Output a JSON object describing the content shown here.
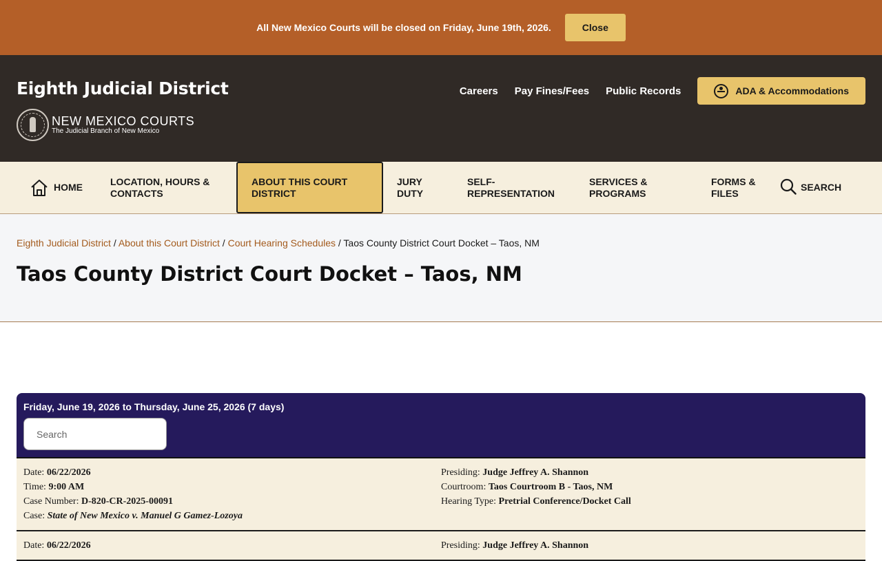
{
  "alert": {
    "message": "All New Mexico Courts will be closed on Friday, June 19th, 2026.",
    "close_label": "Close"
  },
  "header": {
    "site_title": "Eighth Judicial District",
    "brand_name": "NEW MEXICO COURTS",
    "brand_sub": "The Judicial Branch of New Mexico",
    "links": [
      "Careers",
      "Pay Fines/Fees",
      "Public Records"
    ],
    "ada_label": "ADA & Accommodations"
  },
  "nav": {
    "home": "HOME",
    "location": "LOCATION, HOURS & CONTACTS",
    "about": "ABOUT THIS COURT DISTRICT",
    "jury": "JURY DUTY",
    "self": "SELF-REPRESENTATION",
    "services": "SERVICES & PROGRAMS",
    "forms": "FORMS & FILES",
    "search": "SEARCH"
  },
  "breadcrumb": {
    "items": [
      "Eighth Judicial District",
      "About this Court District",
      "Court Hearing Schedules"
    ],
    "current": "Taos County District Court Docket – Taos, NM"
  },
  "page_title": "Taos County District Court Docket – Taos, NM",
  "docket": {
    "range": "Friday, June 19, 2026 to Thursday, June 25, 2026 (7 days)",
    "search_placeholder": "Search",
    "labels": {
      "date": "Date:",
      "time": "Time:",
      "case_number": "Case Number:",
      "case": "Case:",
      "presiding": "Presiding:",
      "courtroom": "Courtroom:",
      "hearing_type": "Hearing Type:"
    },
    "entries": [
      {
        "date": "06/22/2026",
        "time": "9:00 AM",
        "case_number": "D-820-CR-2025-00091",
        "case": "State of New Mexico v. Manuel G Gamez-Lozoya",
        "presiding": "Judge Jeffrey A. Shannon",
        "courtroom": "Taos Courtroom B - Taos, NM",
        "hearing_type": "Pretrial Conference/Docket Call"
      },
      {
        "date": "06/22/2026",
        "presiding": "Judge Jeffrey A. Shannon"
      }
    ]
  }
}
